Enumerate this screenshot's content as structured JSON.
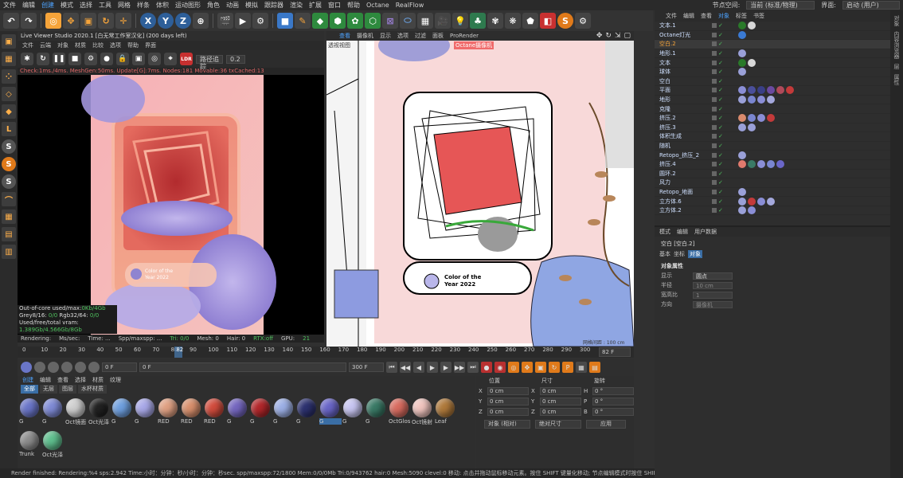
{
  "menubar": {
    "items": [
      "文件",
      "编辑",
      "创建",
      "模式",
      "选择",
      "工具",
      "网格",
      "样条",
      "体积",
      "运动图形",
      "角色",
      "动画",
      "模拟",
      "跟踪器",
      "渲染",
      "扩展",
      "窗口",
      "帮助",
      "Octane",
      "RealFlow"
    ],
    "node_space_label": "节点空间:",
    "node_space_value": "当前 (标准/物理)",
    "layout_label": "界面:",
    "layout_value": "启动 (用户)"
  },
  "live_viewer": {
    "title": "Live Viewer Studio 2020.1 [白无常工作室汉化] (200 days left)",
    "menu": [
      "文件",
      "云端",
      "对象",
      "材质",
      "比较",
      "选项",
      "帮助",
      "界面"
    ],
    "mode_dropdown": "路径追踪",
    "value_field": "0.2",
    "status_line": "Check:1ms./4ms. MeshGen:50ms. Update[G]:7ms. Nodes:181 Movable:36 txCached:13",
    "card_text_1": "Color of the",
    "card_text_2": "Year 2022",
    "info_lines": [
      {
        "label": "Out-of-core used/max:",
        "value": "0Kb/4Gb"
      },
      {
        "label": "Grey8/16: ",
        "value": "0/0",
        "label2": "Rgb32/64: ",
        "value2": "0/0"
      },
      {
        "label": "Used/free/total vram: ",
        "value": "1.389Gb/4.566Gb/8Gb"
      }
    ],
    "render_status": {
      "rendering": "Rendering:",
      "ms_sec": "Ms/sec:",
      "time": "Time: ...",
      "spp": "Spp/maxspp: ...",
      "tri": "Tri: 0/0",
      "mesh": "Mesh: 0",
      "hair": "Hair: 0",
      "rtx": "RTX:off",
      "gpu": "GPU:",
      "gpu_val": "21"
    }
  },
  "viewport": {
    "menu": [
      "查看",
      "摄像机",
      "显示",
      "选项",
      "过滤",
      "面板",
      "ProRender"
    ],
    "camera_label": "透视视图",
    "octane_cam": "Octane摄像机",
    "card_text_1": "Color of the",
    "card_text_2": "Year 2022",
    "grid_label": "网格间距 : 100 cm"
  },
  "timeline": {
    "ticks": [
      "0",
      "10",
      "20",
      "30",
      "40",
      "50",
      "60",
      "70",
      "80",
      "90",
      "100",
      "110",
      "120",
      "130",
      "140",
      "150",
      "160",
      "170",
      "180",
      "190",
      "200",
      "210",
      "220",
      "230",
      "240",
      "250",
      "260",
      "270",
      "280",
      "290",
      "300"
    ],
    "current_frame_label": "82",
    "frame_field": "82 F"
  },
  "playback": {
    "start": "0 F",
    "current": "0 F",
    "end": "300 F",
    "end2": "300 F"
  },
  "material_manager": {
    "menu": [
      "创建",
      "编辑",
      "查看",
      "选择",
      "材质",
      "纹理"
    ],
    "filters": [
      "全部",
      "无层",
      "图层",
      "水杯材质"
    ],
    "materials": [
      {
        "name": "G",
        "color": "#6b76c9"
      },
      {
        "name": "G",
        "color": "#7f8bd6"
      },
      {
        "name": "Oct镜面",
        "color": "#cfcfcf"
      },
      {
        "name": "Oct光泽",
        "color": "#222222"
      },
      {
        "name": "G",
        "color": "#6fa0e0"
      },
      {
        "name": "G",
        "color": "#a9a9e9"
      },
      {
        "name": "RED",
        "color": "#e0a183"
      },
      {
        "name": "RED",
        "color": "#d9906d"
      },
      {
        "name": "RED",
        "color": "#d24c3d"
      },
      {
        "name": "G",
        "color": "#7567c0"
      },
      {
        "name": "G",
        "color": "#b3272b"
      },
      {
        "name": "G",
        "color": "#9db0e6"
      },
      {
        "name": "G",
        "color": "#2d3270"
      },
      {
        "name": "G",
        "color": "#6a66c8"
      },
      {
        "name": "G",
        "color": "#c8c6f2"
      },
      {
        "name": "G",
        "color": "#3a7a66"
      },
      {
        "name": "OctGlos",
        "color": "#d96c60"
      },
      {
        "name": "Oct镜射",
        "color": "#f1c5bf"
      },
      {
        "name": "Leaf",
        "color": "#b07a3b"
      },
      {
        "name": "Trunk",
        "color": "#8d8d8d"
      },
      {
        "name": "Oct光泽",
        "color": "#5fbf8e"
      }
    ]
  },
  "coords": {
    "headers": [
      "位置",
      "尺寸",
      "旋转"
    ],
    "rows": [
      {
        "axis": "X",
        "pos": "0 cm",
        "size_axis": "X",
        "size": "0 cm",
        "rot_axis": "H",
        "rot": "0 °"
      },
      {
        "axis": "Y",
        "pos": "0 cm",
        "size_axis": "Y",
        "size": "0 cm",
        "rot_axis": "P",
        "rot": "0 °"
      },
      {
        "axis": "Z",
        "pos": "0 cm",
        "size_axis": "Z",
        "size": "0 cm",
        "rot_axis": "B",
        "rot": "0 °"
      }
    ],
    "mode": "对象 (相对)",
    "size_mode": "绝对尺寸",
    "apply": "应用"
  },
  "object_manager": {
    "tabs": [
      "文件",
      "编辑",
      "查看",
      "对象",
      "标签",
      "书签"
    ],
    "objects": [
      {
        "name": "文本.1",
        "tags": [
          "#2a7a2a",
          "#d8d8d8"
        ]
      },
      {
        "name": "Octane灯光",
        "tags": [
          "#3a7ad4"
        ]
      },
      {
        "name": "空白.2",
        "tags": []
      },
      {
        "name": "地形.1",
        "tags": [
          "#9aa0d8"
        ]
      },
      {
        "name": "文本",
        "tags": [
          "#2a7a2a",
          "#d8d8d8"
        ]
      },
      {
        "name": "球体",
        "tags": [
          "#9aa0d8"
        ]
      },
      {
        "name": "空白",
        "tags": []
      },
      {
        "name": "平面",
        "tags": [
          "#8a8ed6",
          "#4a4f9a",
          "#3a3f86",
          "#6a4aa0",
          "#b04a5a",
          "#c33a3a"
        ]
      },
      {
        "name": "地形",
        "tags": [
          "#9aa0d8",
          "#7a86d0",
          "#8a8ed6",
          "#a4a8dc"
        ]
      },
      {
        "name": "克隆",
        "tags": []
      },
      {
        "name": "挤压.2",
        "tags": [
          "#d98a6d",
          "#7a86d0",
          "#8a8ed6",
          "#c33a3a"
        ]
      },
      {
        "name": "挤压.3",
        "tags": [
          "#9aa0d8",
          "#9aa0d8"
        ]
      },
      {
        "name": "体积生成",
        "tags": []
      },
      {
        "name": "随机",
        "tags": []
      },
      {
        "name": "Retopo_挤压_2",
        "tags": [
          "#9aa0d8"
        ]
      },
      {
        "name": "挤压.4",
        "tags": [
          "#e07a6d",
          "#3a7a66",
          "#8a8ed6",
          "#7a86d0",
          "#6a66c8"
        ]
      },
      {
        "name": "圆环.2",
        "tags": []
      },
      {
        "name": "风力",
        "tags": []
      },
      {
        "name": "Retopo_地面",
        "tags": [
          "#9aa0d8"
        ]
      },
      {
        "name": "立方体.6",
        "tags": [
          "#9aa0d8",
          "#c33a3a",
          "#8a8ed6",
          "#a4a8dc"
        ]
      },
      {
        "name": "立方体.2",
        "tags": [
          "#9aa0d8",
          "#8a8ed6"
        ]
      }
    ]
  },
  "attributes": {
    "menu": [
      "模式",
      "编辑",
      "用户数据"
    ],
    "object_name": "空白 [空白.2]",
    "tabs": [
      "基本",
      "坐标",
      "对象"
    ],
    "section": "对象属性",
    "fields": [
      {
        "label": "显示",
        "value": "圆点"
      },
      {
        "label": "半径",
        "value": "10 cm"
      },
      {
        "label": "宽高比",
        "value": "1"
      },
      {
        "label": "方向",
        "value": "摄像机"
      }
    ]
  },
  "far_right_tabs": [
    "对象",
    "内容浏览器",
    "层",
    "属性"
  ],
  "statusbar": "Render finished: Rendering:%4 sps:2.942 Time:小时：分钟：秒/小时：分钟：秒sec. spp/maxspp:72/1800 Mem:0/0/0Mb Tri:0/943762 hair:0 Mesh:5090 clevel:0     移动: 点击并拖动鼠标移动元素。按住 SHIFT 键量化移动; 节点编辑模式时按住 SHIFT 键增加选择对象"
}
